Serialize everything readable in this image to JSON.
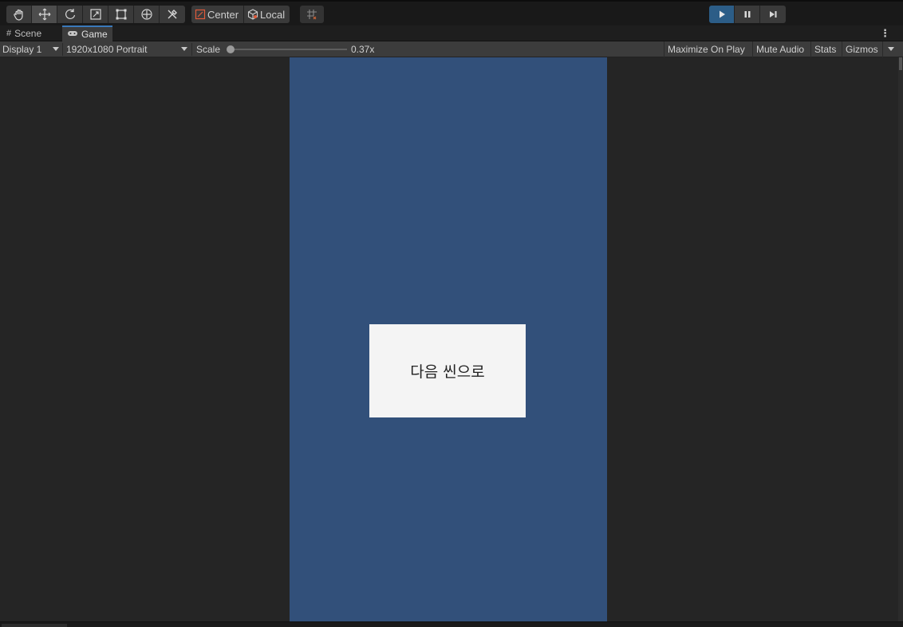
{
  "toolbar": {
    "tools": [
      "hand-tool",
      "move-tool",
      "rotate-tool",
      "scale-tool",
      "rect-tool",
      "transform-tool",
      "custom-tool"
    ],
    "pivot_label": "Center",
    "space_label": "Local"
  },
  "tabs": [
    {
      "label": "Scene",
      "icon": "grid-icon"
    },
    {
      "label": "Game",
      "icon": "gamepad-icon"
    }
  ],
  "gamebar": {
    "display": "Display 1",
    "resolution": "1920x1080 Portrait",
    "scale_label": "Scale",
    "scale_value": "0.37x",
    "maximize": "Maximize On Play",
    "mute": "Mute Audio",
    "stats": "Stats",
    "gizmos": "Gizmos"
  },
  "game": {
    "button_label": "다음 씬으로",
    "background_color": "#32507a"
  },
  "colors": {
    "accent": "#3a79bb",
    "play_active": "#2c5d87"
  }
}
